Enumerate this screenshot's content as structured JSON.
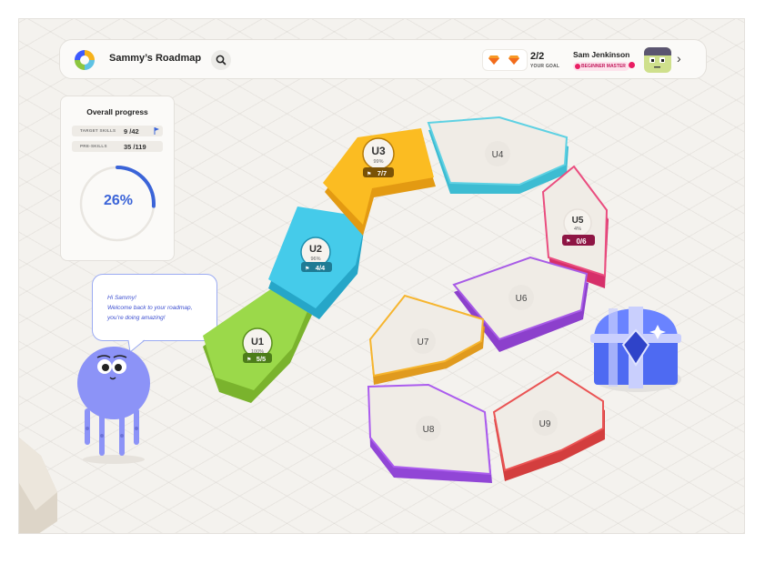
{
  "header": {
    "title": "Sammy’s Roadmap",
    "goal_count": "2/2",
    "goal_label": "YOUR GOAL",
    "user_name": "Sam Jenkinson",
    "user_badge": "BEGINNER MASTER"
  },
  "progress": {
    "title": "Overall progress",
    "target_label": "TARGET SKILLS",
    "target_value": "9 /42",
    "pre_label": "PRE-SKILLS",
    "pre_value": "35 /119",
    "percent_text": "26%",
    "percent_value": 0.26
  },
  "mascot": {
    "line1": "Hi Sammy!",
    "line2": "Welcome back to your roadmap,",
    "line3": "you’re doing amazing!"
  },
  "units": [
    {
      "id": "U1",
      "percent": "100%",
      "flags": "5/5",
      "color": "#8fcd3c"
    },
    {
      "id": "U2",
      "percent": "96%",
      "flags": "4/4",
      "color": "#36c1e0"
    },
    {
      "id": "U3",
      "percent": "99%",
      "flags": "7/7",
      "color": "#f9b51b"
    },
    {
      "id": "U4",
      "color": "#5ed1e3"
    },
    {
      "id": "U5",
      "percent": "4%",
      "flags": "0/6",
      "color": "#ea4d7f"
    },
    {
      "id": "U6",
      "color": "#a85ce6"
    },
    {
      "id": "U7",
      "color": "#f6b52f"
    },
    {
      "id": "U8",
      "color": "#ab5cee"
    },
    {
      "id": "U9",
      "color": "#ea5454"
    }
  ],
  "icons": [
    "search-icon",
    "gem-icon",
    "chevron-right-icon",
    "flag-icon",
    "treasure-chest-icon"
  ]
}
